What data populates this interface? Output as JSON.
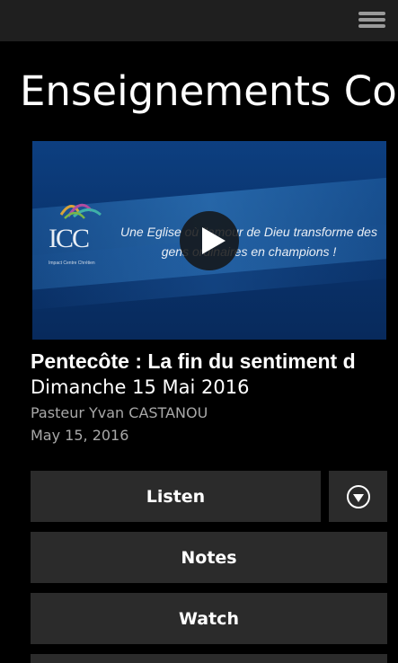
{
  "app": {
    "page_title": "Enseignements Cont"
  },
  "topbar": {
    "menu_icon": "hamburger-menu-icon"
  },
  "video": {
    "logo_letters": "ICC",
    "logo_subtitle": "Impact Centre Chrétien",
    "tagline": "Une Eglise où l'amour de Dieu transforme des gens ordinaires en champions !",
    "play_icon": "play-icon"
  },
  "sermon": {
    "title": "Pentecôte : La fin du sentiment d",
    "subtitle": "Dimanche 15 Mai 2016",
    "speaker": "Pasteur Yvan CASTANOU",
    "date": "May 15, 2016"
  },
  "actions": {
    "listen_label": "Listen",
    "download_icon": "download-circle-icon",
    "notes_label": "Notes",
    "watch_label": "Watch"
  },
  "colors": {
    "background": "#000000",
    "topbar": "#1f1f1f",
    "button": "#2b2b2b",
    "secondary_text": "#a8a8a8"
  }
}
